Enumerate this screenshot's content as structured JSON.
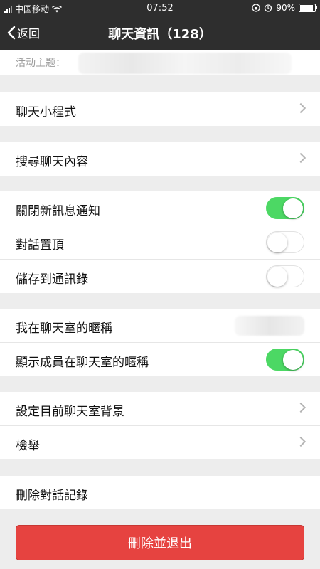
{
  "status_bar": {
    "carrier": "中国移动",
    "time": "07:52",
    "battery": "90%",
    "battery_level": 0.9
  },
  "nav": {
    "back_label": "返回",
    "title": "聊天資訊（128）"
  },
  "topic": {
    "label": "活动主题："
  },
  "groups": {
    "mini_program": "聊天小程式",
    "search": "搜尋聊天內容",
    "mute": "關閉新訊息通知",
    "mute_on": true,
    "pin": "對話置頂",
    "pin_on": false,
    "save_contacts": "儲存到通訊錄",
    "save_on": false,
    "my_nickname": "我在聊天室的暱稱",
    "show_nicknames": "顯示成員在聊天室的暱稱",
    "show_nicknames_on": true,
    "background": "設定目前聊天室背景",
    "report": "檢舉",
    "clear_history": "刪除對話記錄"
  },
  "exit_button": {
    "label": "刪除並退出"
  }
}
